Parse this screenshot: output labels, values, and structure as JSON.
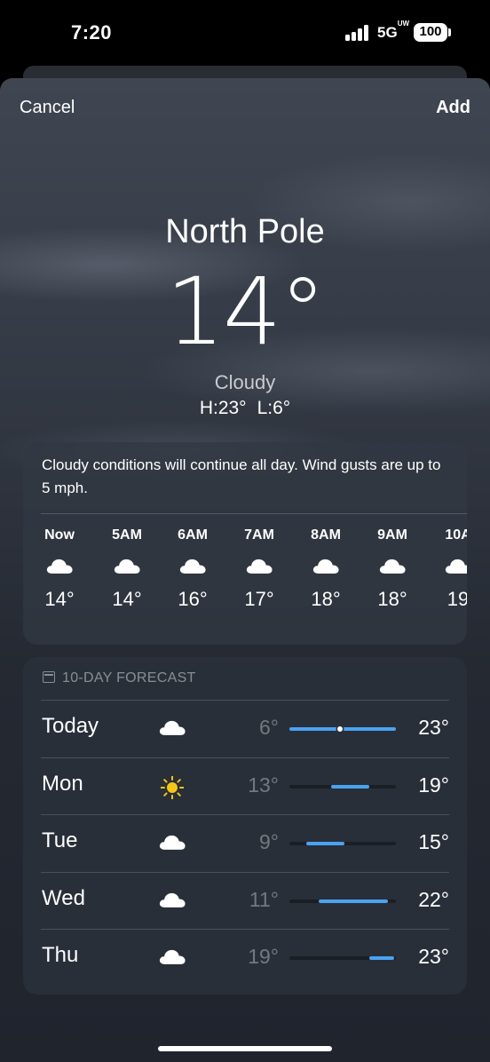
{
  "status_bar": {
    "time": "7:20",
    "network": "5G",
    "network_sup": "UW",
    "battery": "100"
  },
  "nav": {
    "cancel_label": "Cancel",
    "add_label": "Add"
  },
  "current": {
    "location": "North Pole",
    "temperature": "14°",
    "condition": "Cloudy",
    "high": "H:23°",
    "low": "L:6°"
  },
  "hourly": {
    "summary": "Cloudy conditions will continue all day. Wind gusts are up to 5 mph.",
    "hours": [
      {
        "label": "Now",
        "icon": "cloud-icon",
        "temp": "14°"
      },
      {
        "label": "5AM",
        "icon": "cloud-icon",
        "temp": "14°"
      },
      {
        "label": "6AM",
        "icon": "cloud-icon",
        "temp": "16°"
      },
      {
        "label": "7AM",
        "icon": "cloud-icon",
        "temp": "17°"
      },
      {
        "label": "8AM",
        "icon": "cloud-icon",
        "temp": "18°"
      },
      {
        "label": "9AM",
        "icon": "cloud-icon",
        "temp": "18°"
      },
      {
        "label": "10A",
        "icon": "cloud-icon",
        "temp": "19"
      }
    ]
  },
  "forecast": {
    "header": "10-DAY FORECAST",
    "range_min": 6,
    "range_max": 23,
    "days": [
      {
        "day": "Today",
        "icon": "cloud-icon",
        "low": "6°",
        "high": "23°",
        "low_value": 6,
        "high_value": 23,
        "current_value": 14
      },
      {
        "day": "Mon",
        "icon": "sun-icon",
        "low": "13°",
        "high": "19°",
        "low_value": 13,
        "high_value": 19
      },
      {
        "day": "Tue",
        "icon": "cloud-icon",
        "low": "9°",
        "high": "15°",
        "low_value": 9,
        "high_value": 15
      },
      {
        "day": "Wed",
        "icon": "cloud-icon",
        "low": "11°",
        "high": "22°",
        "low_value": 11,
        "high_value": 22
      },
      {
        "day": "Thu",
        "icon": "cloud-icon",
        "low": "19°",
        "high": "23°",
        "low_value": 19,
        "high_value": 23
      }
    ]
  },
  "colors": {
    "accent_bar": "#4aa3f0",
    "sun": "#f5c518"
  }
}
